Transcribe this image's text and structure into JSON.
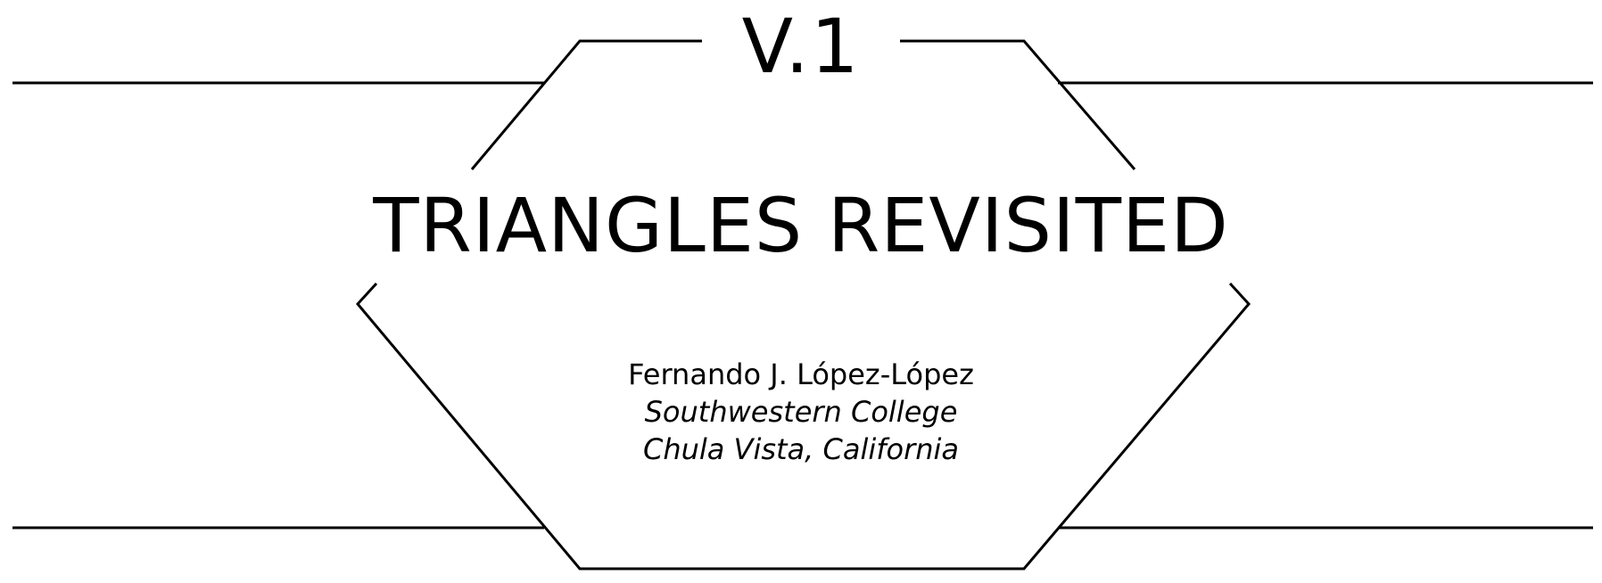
{
  "header": {
    "section_number": "V.1",
    "title": "TRIANGLES REVISITED"
  },
  "author": {
    "name": "Fernando J. López-López",
    "institution": "Southwestern College",
    "location": "Chula Vista, California"
  },
  "colors": {
    "ink": "#000000",
    "paper": "#ffffff"
  }
}
